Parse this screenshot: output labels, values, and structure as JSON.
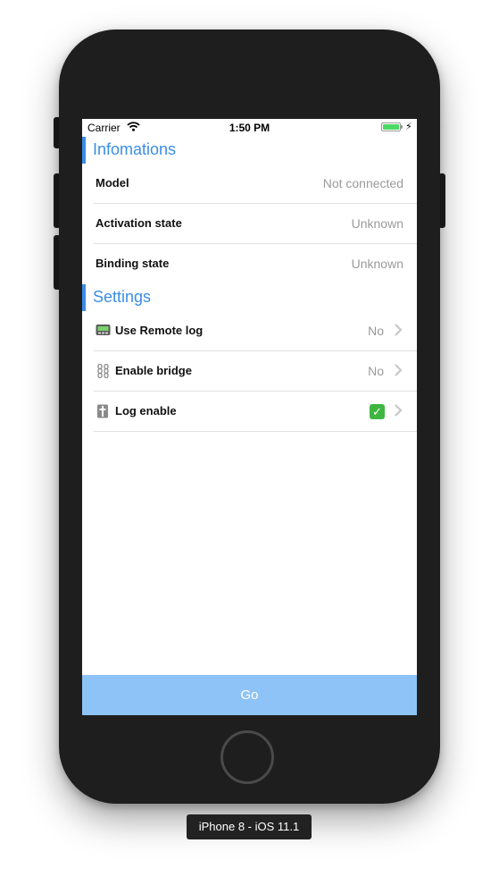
{
  "status_bar": {
    "carrier": "Carrier",
    "time": "1:50 PM",
    "battery_color": "#4cd964"
  },
  "sections": {
    "info": {
      "title": "Infomations",
      "rows": [
        {
          "label": "Model",
          "value": "Not connected"
        },
        {
          "label": "Activation state",
          "value": "Unknown"
        },
        {
          "label": "Binding state",
          "value": "Unknown"
        }
      ]
    },
    "settings": {
      "title": "Settings",
      "rows": [
        {
          "icon": "pager-icon",
          "label": "Use Remote log",
          "value": "No"
        },
        {
          "icon": "chain-link-icon",
          "label": "Enable bridge",
          "value": "No"
        },
        {
          "icon": "dagger-icon",
          "label": "Log enable",
          "value_icon": "check-mark-icon"
        }
      ]
    }
  },
  "go_button": {
    "label": "Go"
  },
  "device_label": "iPhone 8 - iOS 11.1",
  "colors": {
    "accent": "#3a8ee6",
    "go_bar": "#8ec3f7",
    "secondary_text": "#9a9a9a",
    "check_green": "#3fb63f"
  }
}
